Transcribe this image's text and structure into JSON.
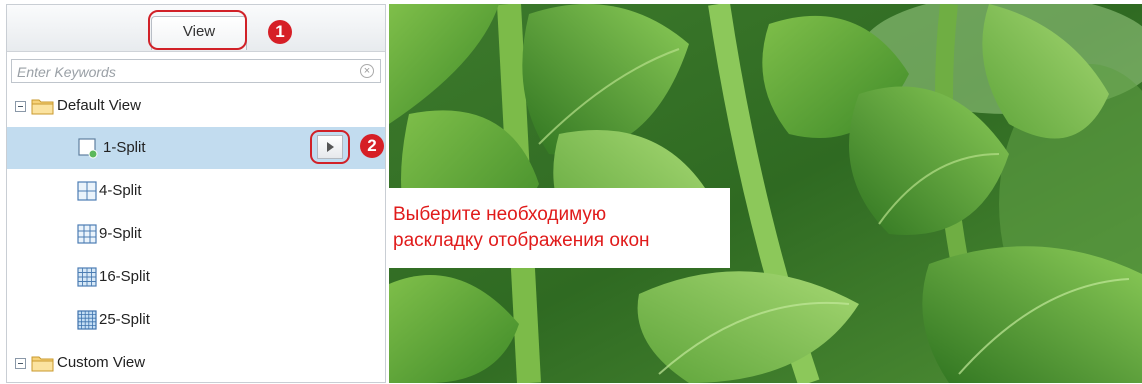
{
  "panel": {
    "view_tab": "View",
    "search_placeholder": "Enter Keywords",
    "tree": {
      "default_view": "Default View",
      "items": [
        "1-Split",
        "4-Split",
        "9-Split",
        "16-Split",
        "25-Split"
      ],
      "custom_view": "Custom View"
    }
  },
  "annotations": {
    "badge1": "1",
    "badge2": "2",
    "callout_line1": "Выберите необходимую",
    "callout_line2": "раскладку отображения окон",
    "highlight_color": "#d12128",
    "text_color": "#e01b1b"
  },
  "selection_color": "#c2dcef"
}
